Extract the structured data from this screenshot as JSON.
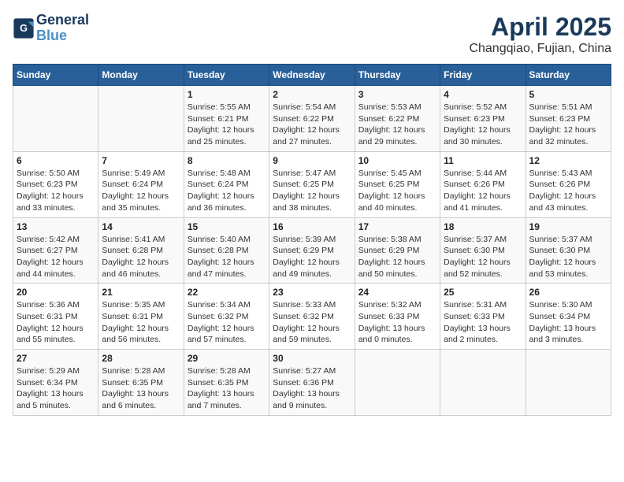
{
  "header": {
    "logo_line1": "General",
    "logo_line2": "Blue",
    "month_year": "April 2025",
    "location": "Changqiao, Fujian, China"
  },
  "weekdays": [
    "Sunday",
    "Monday",
    "Tuesday",
    "Wednesday",
    "Thursday",
    "Friday",
    "Saturday"
  ],
  "weeks": [
    [
      {
        "day": "",
        "info": ""
      },
      {
        "day": "",
        "info": ""
      },
      {
        "day": "1",
        "info": "Sunrise: 5:55 AM\nSunset: 6:21 PM\nDaylight: 12 hours\nand 25 minutes."
      },
      {
        "day": "2",
        "info": "Sunrise: 5:54 AM\nSunset: 6:22 PM\nDaylight: 12 hours\nand 27 minutes."
      },
      {
        "day": "3",
        "info": "Sunrise: 5:53 AM\nSunset: 6:22 PM\nDaylight: 12 hours\nand 29 minutes."
      },
      {
        "day": "4",
        "info": "Sunrise: 5:52 AM\nSunset: 6:23 PM\nDaylight: 12 hours\nand 30 minutes."
      },
      {
        "day": "5",
        "info": "Sunrise: 5:51 AM\nSunset: 6:23 PM\nDaylight: 12 hours\nand 32 minutes."
      }
    ],
    [
      {
        "day": "6",
        "info": "Sunrise: 5:50 AM\nSunset: 6:23 PM\nDaylight: 12 hours\nand 33 minutes."
      },
      {
        "day": "7",
        "info": "Sunrise: 5:49 AM\nSunset: 6:24 PM\nDaylight: 12 hours\nand 35 minutes."
      },
      {
        "day": "8",
        "info": "Sunrise: 5:48 AM\nSunset: 6:24 PM\nDaylight: 12 hours\nand 36 minutes."
      },
      {
        "day": "9",
        "info": "Sunrise: 5:47 AM\nSunset: 6:25 PM\nDaylight: 12 hours\nand 38 minutes."
      },
      {
        "day": "10",
        "info": "Sunrise: 5:45 AM\nSunset: 6:25 PM\nDaylight: 12 hours\nand 40 minutes."
      },
      {
        "day": "11",
        "info": "Sunrise: 5:44 AM\nSunset: 6:26 PM\nDaylight: 12 hours\nand 41 minutes."
      },
      {
        "day": "12",
        "info": "Sunrise: 5:43 AM\nSunset: 6:26 PM\nDaylight: 12 hours\nand 43 minutes."
      }
    ],
    [
      {
        "day": "13",
        "info": "Sunrise: 5:42 AM\nSunset: 6:27 PM\nDaylight: 12 hours\nand 44 minutes."
      },
      {
        "day": "14",
        "info": "Sunrise: 5:41 AM\nSunset: 6:28 PM\nDaylight: 12 hours\nand 46 minutes."
      },
      {
        "day": "15",
        "info": "Sunrise: 5:40 AM\nSunset: 6:28 PM\nDaylight: 12 hours\nand 47 minutes."
      },
      {
        "day": "16",
        "info": "Sunrise: 5:39 AM\nSunset: 6:29 PM\nDaylight: 12 hours\nand 49 minutes."
      },
      {
        "day": "17",
        "info": "Sunrise: 5:38 AM\nSunset: 6:29 PM\nDaylight: 12 hours\nand 50 minutes."
      },
      {
        "day": "18",
        "info": "Sunrise: 5:37 AM\nSunset: 6:30 PM\nDaylight: 12 hours\nand 52 minutes."
      },
      {
        "day": "19",
        "info": "Sunrise: 5:37 AM\nSunset: 6:30 PM\nDaylight: 12 hours\nand 53 minutes."
      }
    ],
    [
      {
        "day": "20",
        "info": "Sunrise: 5:36 AM\nSunset: 6:31 PM\nDaylight: 12 hours\nand 55 minutes."
      },
      {
        "day": "21",
        "info": "Sunrise: 5:35 AM\nSunset: 6:31 PM\nDaylight: 12 hours\nand 56 minutes."
      },
      {
        "day": "22",
        "info": "Sunrise: 5:34 AM\nSunset: 6:32 PM\nDaylight: 12 hours\nand 57 minutes."
      },
      {
        "day": "23",
        "info": "Sunrise: 5:33 AM\nSunset: 6:32 PM\nDaylight: 12 hours\nand 59 minutes."
      },
      {
        "day": "24",
        "info": "Sunrise: 5:32 AM\nSunset: 6:33 PM\nDaylight: 13 hours\nand 0 minutes."
      },
      {
        "day": "25",
        "info": "Sunrise: 5:31 AM\nSunset: 6:33 PM\nDaylight: 13 hours\nand 2 minutes."
      },
      {
        "day": "26",
        "info": "Sunrise: 5:30 AM\nSunset: 6:34 PM\nDaylight: 13 hours\nand 3 minutes."
      }
    ],
    [
      {
        "day": "27",
        "info": "Sunrise: 5:29 AM\nSunset: 6:34 PM\nDaylight: 13 hours\nand 5 minutes."
      },
      {
        "day": "28",
        "info": "Sunrise: 5:28 AM\nSunset: 6:35 PM\nDaylight: 13 hours\nand 6 minutes."
      },
      {
        "day": "29",
        "info": "Sunrise: 5:28 AM\nSunset: 6:35 PM\nDaylight: 13 hours\nand 7 minutes."
      },
      {
        "day": "30",
        "info": "Sunrise: 5:27 AM\nSunset: 6:36 PM\nDaylight: 13 hours\nand 9 minutes."
      },
      {
        "day": "",
        "info": ""
      },
      {
        "day": "",
        "info": ""
      },
      {
        "day": "",
        "info": ""
      }
    ]
  ]
}
